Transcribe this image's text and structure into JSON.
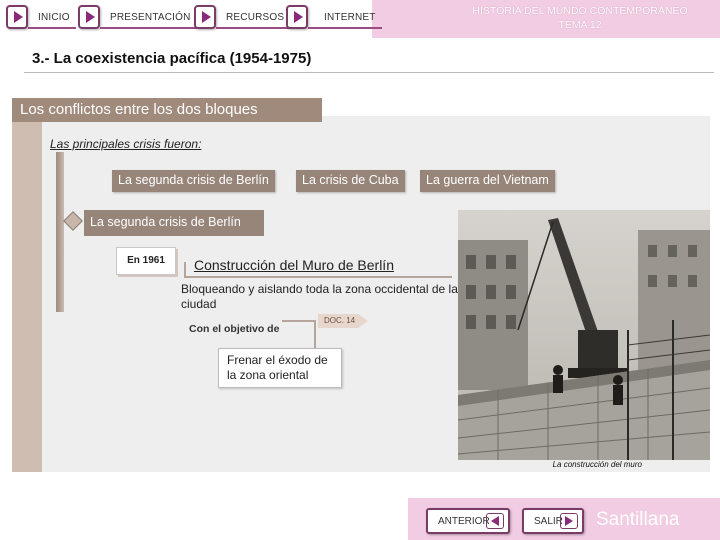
{
  "nav": {
    "items": [
      {
        "label": "INICIO"
      },
      {
        "label": "PRESENTACIÓN"
      },
      {
        "label": "RECURSOS"
      },
      {
        "label": "INTERNET"
      }
    ],
    "header_line1": "HISTORIA DEL MUNDO CONTEMPORÁNEO",
    "header_line2": "TEMA 12"
  },
  "section": {
    "title": "3.- La coexistencia pacífica (1954-1975)",
    "subtitle": "Los conflictos entre los dos bloques",
    "intro": "Las principales crisis fueron:"
  },
  "crisis_buttons": [
    {
      "label": "La segunda crisis de Berlín"
    },
    {
      "label": "La crisis de Cuba"
    },
    {
      "label": "La guerra del Vietnam"
    }
  ],
  "berlin": {
    "title": "La segunda crisis de Berlín",
    "year": "En 1961",
    "event": "Construcción del Muro de Berlín",
    "detail": "Bloqueando y aislando toda la zona occidental de la ciudad",
    "purpose_label": "Con el objetivo de",
    "doc_ref": "DOC. 14",
    "purpose": "Frenar el éxodo de la zona oriental"
  },
  "photo": {
    "caption": "La construcción del muro"
  },
  "footer": {
    "prev_label": "ANTERIOR",
    "exit_label": "SALIR",
    "brand": "Santillana"
  },
  "colors": {
    "accent_pink": "#f1cce2",
    "nav_border": "#7a3b66",
    "crisis_button": "#97857a",
    "subtitle_bar": "#a08a7c"
  }
}
